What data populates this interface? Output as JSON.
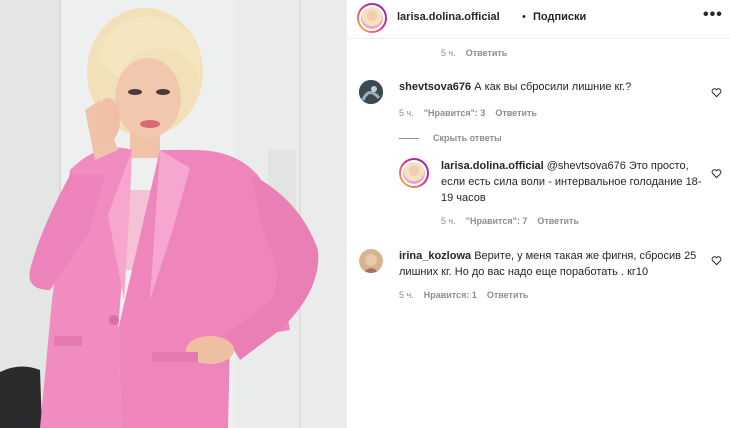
{
  "header": {
    "username": "larisa.dolina.official",
    "separator": "•",
    "follow_label": "Подписки",
    "more_icon": "more-horizontal-icon"
  },
  "top_meta": {
    "time": "5 ч.",
    "reply": "Ответить"
  },
  "comments": [
    {
      "username": "shevtsova676",
      "text": "А как вы сбросили лишние кг.?",
      "time": "5 ч.",
      "likes": "\"Нравится\": 3",
      "reply": "Ответить",
      "avatar_color": "#3b4a52"
    },
    {
      "username": "irina_kozlowa",
      "text": "Верите, у меня такая же фигня, сбросив 25 лишних кг. Но до вас надо еще поработать . кг10",
      "time": "5 ч.",
      "likes": "Нравится: 1",
      "reply": "Ответить",
      "avatar_color": "#c9a17a"
    }
  ],
  "hide_replies": "Скрыть ответы",
  "reply": {
    "username": "larisa.dolina.official",
    "text": "@shevtsova676 Это просто, если есть сила воли - интервальное голодание 18-19 часов",
    "time": "5 ч.",
    "likes": "\"Нравится\": 7",
    "reply": "Ответить"
  },
  "colors": {
    "accent_gradient": [
      "#f9ce34",
      "#ee2a7b",
      "#6228d7"
    ],
    "meta_gray": "#8e8e8e",
    "suit_pink": "#ef8fc3"
  }
}
